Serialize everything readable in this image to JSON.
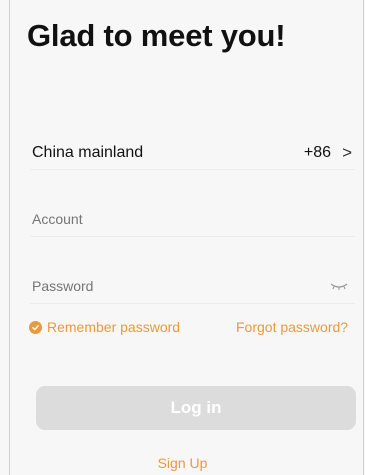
{
  "header": {
    "title": "Glad to meet you!"
  },
  "region": {
    "label": "China mainland",
    "code": "+86",
    "chevron": ">"
  },
  "account": {
    "placeholder": "Account"
  },
  "password": {
    "placeholder": "Password",
    "toggle_icon": "eye-closed-icon"
  },
  "options": {
    "remember_label": "Remember password",
    "remember_checked": true,
    "forgot_label": "Forgot password?"
  },
  "actions": {
    "login_label": "Log in",
    "signup_label": "Sign Up"
  },
  "colors": {
    "accent": "#e89a3c",
    "button_disabled": "#dcdcdc",
    "background": "#f7f7f7"
  }
}
